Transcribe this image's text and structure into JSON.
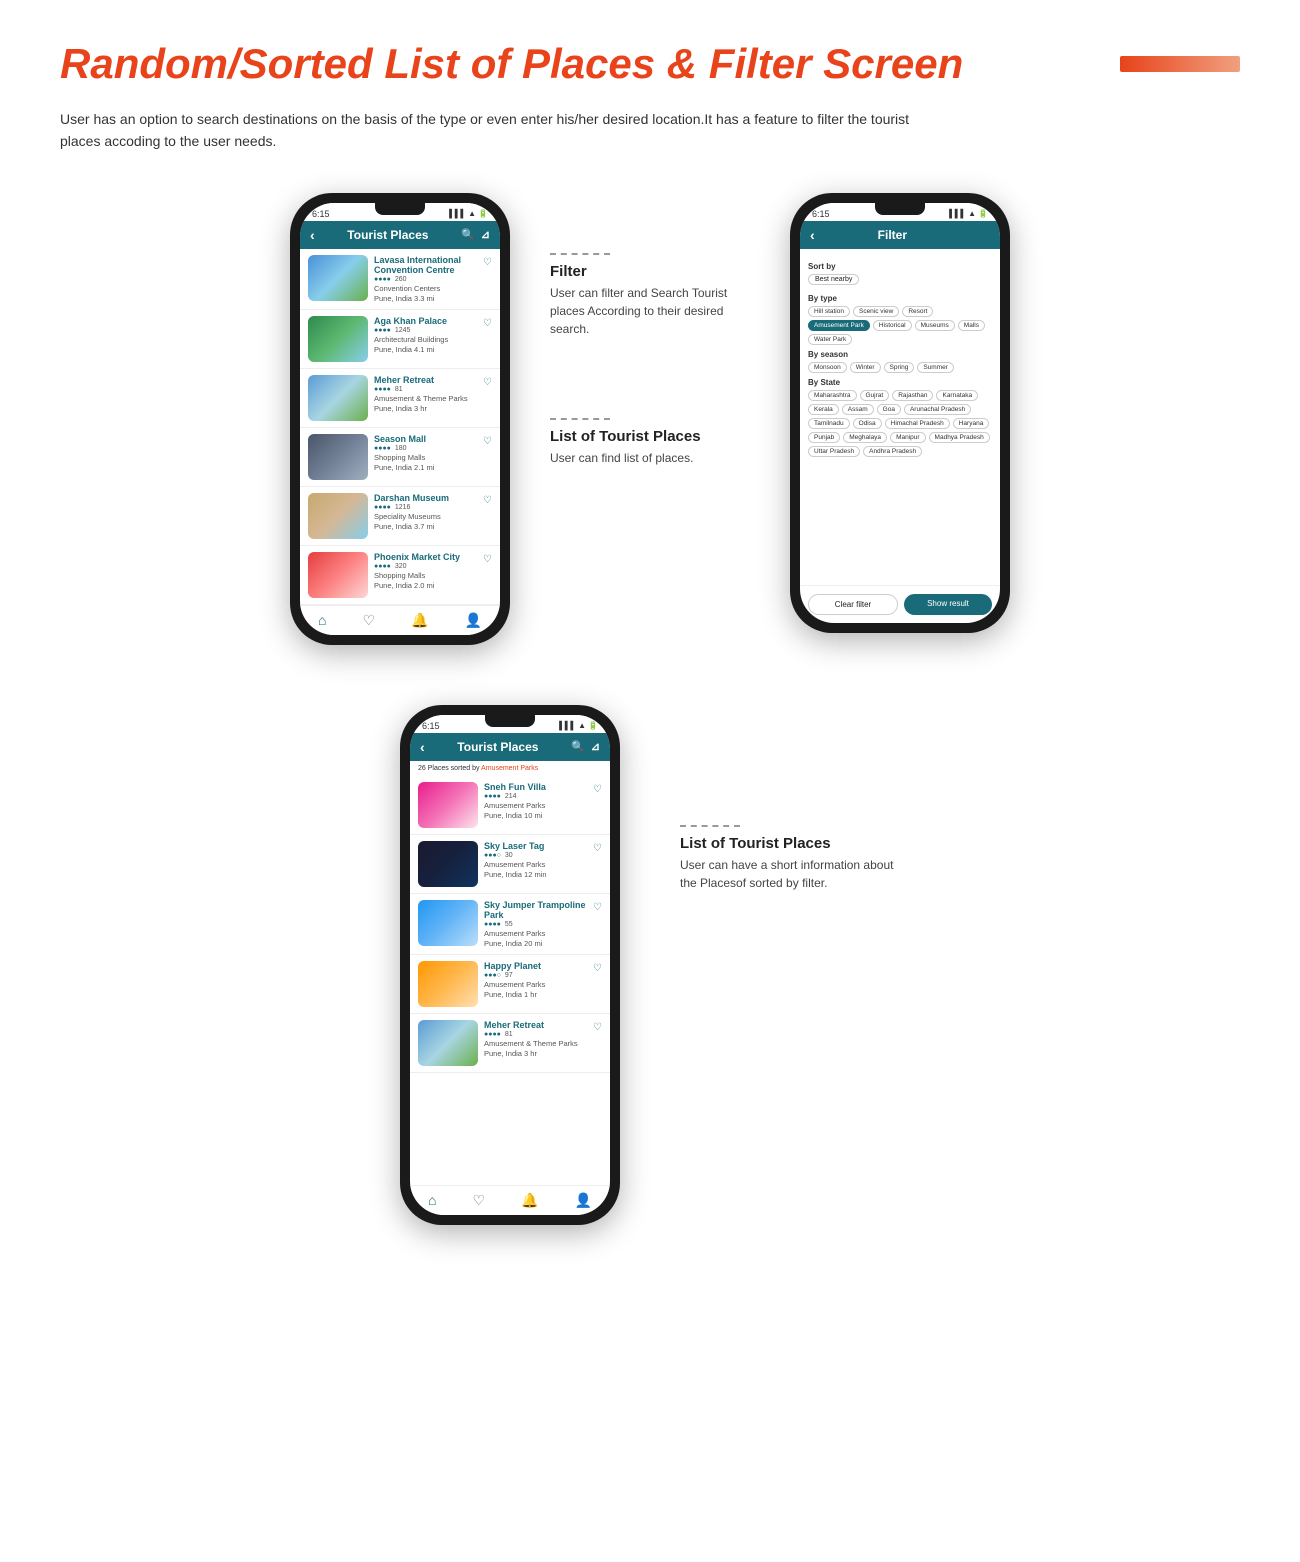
{
  "page": {
    "title": "Random/Sorted List of Places & Filter Screen",
    "description": "User has an option to search destinations on the basis of the type or even enter his/her desired location.It has a feature to filter the tourist places accoding to the user needs.",
    "accent_color": "#e8431a"
  },
  "phone1": {
    "time": "6:15",
    "header_title": "Tourist Places",
    "places": [
      {
        "name": "Lavasa International Convention Centre",
        "stars": "●●●●",
        "rating": "260",
        "category": "Convention Centers",
        "location": "Pune, India  3.3 mi",
        "thumb": "thumb-lavasa"
      },
      {
        "name": "Aga Khan Palace",
        "stars": "●●●●",
        "rating": "1245",
        "category": "Architectural Buildings",
        "location": "Pune, India  4.1 mi",
        "thumb": "thumb-agakhan"
      },
      {
        "name": "Meher Retreat",
        "stars": "●●●●",
        "rating": "81",
        "category": "Amusement & Theme Parks",
        "location": "Pune, India  3 hr",
        "thumb": "thumb-meher"
      },
      {
        "name": "Season Mall",
        "stars": "●●●●",
        "rating": "180",
        "category": "Shopping Malls",
        "location": "Pune, India  2.1 mi",
        "thumb": "thumb-season"
      },
      {
        "name": "Darshan Museum",
        "stars": "●●●●",
        "rating": "1216",
        "category": "Speciality Museums",
        "location": "Pune, India  3.7 mi",
        "thumb": "thumb-darshan"
      },
      {
        "name": "Phoenix Market City",
        "stars": "●●●●",
        "rating": "320",
        "category": "Shopping Malls",
        "location": "Pune, India  2.0 mi",
        "thumb": "thumb-phoenix"
      }
    ]
  },
  "phone2": {
    "time": "6:15",
    "header_title": "Filter",
    "sort_by_label": "Sort by",
    "sort_option": "Best nearby",
    "by_type_label": "By type",
    "type_tags": [
      "Hill station",
      "Scenic view",
      "Resort",
      "Amusement Park",
      "Historical",
      "Museums",
      "Malls",
      "Water Park"
    ],
    "active_type": "Amusement Park",
    "by_season_label": "By season",
    "season_tags": [
      "Monsoon",
      "Winter",
      "Spring",
      "Summer"
    ],
    "by_state_label": "By State",
    "state_tags": [
      "Maharashtra",
      "Gujrat",
      "Rajasthan",
      "Karnataka",
      "Kerala",
      "Assam",
      "Goa",
      "Arunachal Pradesh",
      "Tamilnadu",
      "Odisa",
      "Himachal Pradesh",
      "Haryana",
      "Punjab",
      "Meghalaya",
      "Manipur",
      "Madhya Pradesh",
      "Uttar Pradesh",
      "Andhra Pradesh"
    ],
    "clear_filter_label": "Clear filter",
    "show_result_label": "Show result"
  },
  "phone3": {
    "time": "6:15",
    "header_title": "Tourist Places",
    "filter_banner": "26 Places sorted by Amusement Parks",
    "places": [
      {
        "name": "Sneh Fun Villa",
        "stars": "●●●●",
        "rating": "214",
        "category": "Amusement Parks",
        "location": "Pune, India  10 mi",
        "thumb": "thumb-sneh"
      },
      {
        "name": "Sky Laser Tag",
        "stars": "●●●○",
        "rating": "30",
        "category": "Amusement Parks",
        "location": "Pune, India  12 min",
        "thumb": "thumb-sky"
      },
      {
        "name": "Sky Jumper Trampoline Park",
        "stars": "●●●●",
        "rating": "55",
        "category": "Amusement Parks",
        "location": "Pune, India  20 mi",
        "thumb": "thumb-jumper"
      },
      {
        "name": "Happy Planet",
        "stars": "●●●○",
        "rating": "97",
        "category": "Amusement Parks",
        "location": "Pune, India  1 hr",
        "thumb": "thumb-happy"
      },
      {
        "name": "Meher Retreat",
        "stars": "●●●●",
        "rating": "81",
        "category": "Amusement & Theme Parks",
        "location": "Pune, India  3 hr",
        "thumb": "thumb-meher"
      }
    ]
  },
  "annotations": {
    "filter_title": "Filter",
    "filter_text": "User can filter and Search Tourist places According to their desired search.",
    "list_title": "List of Tourist Places",
    "list_text": "User can find list of places.",
    "list2_title": "List of Tourist Places",
    "list2_text": "User can have a short information about the Placesof sorted by filter."
  }
}
